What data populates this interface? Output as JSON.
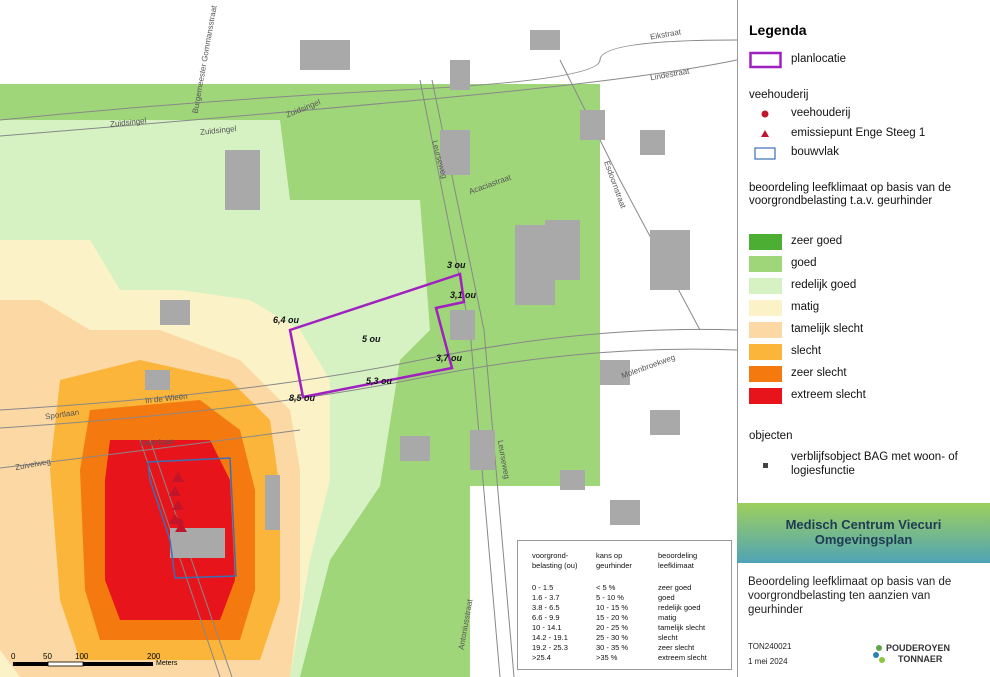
{
  "legend": {
    "title": "Legenda",
    "planlocatie": "planlocatie",
    "veehouderij_header": "veehouderij",
    "veehouderij": "veehouderij",
    "emissiepunt": "emissiepunt Enge Steeg 1",
    "bouwvlak": "bouwvlak",
    "beoordeling_header": "beoordeling leefklimaat op basis van de voorgrondbelasting t.a.v. geurhinder",
    "classes": [
      {
        "label": "zeer goed",
        "color": "#4cae33"
      },
      {
        "label": "goed",
        "color": "#9fd679"
      },
      {
        "label": "redelijk goed",
        "color": "#d6f2c2"
      },
      {
        "label": "matig",
        "color": "#fbf2c8"
      },
      {
        "label": "tamelijk slecht",
        "color": "#fcd9a4"
      },
      {
        "label": "slecht",
        "color": "#fbb53a"
      },
      {
        "label": "zeer slecht",
        "color": "#f47a10"
      },
      {
        "label": "extreem slecht",
        "color": "#e8141c"
      }
    ],
    "objecten_header": "objecten",
    "verblijf": "verblijfsobject BAG met woon- of logiesfunctie"
  },
  "title_block": {
    "line1": "Medisch Centrum Viecuri",
    "line2": "Omgevingsplan",
    "description": "Beoordeling leefklimaat op basis van de voorgrondbelasting ten aanzien van geurhinder",
    "code": "TON240021",
    "date": "1 mei 2024",
    "logo_line1": "POUDEROYEN",
    "logo_line2": "TONNAER"
  },
  "map_labels": [
    {
      "text": "3 ou"
    },
    {
      "text": "3,1 ou"
    },
    {
      "text": "6,4 ou"
    },
    {
      "text": "5 ou"
    },
    {
      "text": "3,7 ou"
    },
    {
      "text": "5,3 ou"
    },
    {
      "text": "8,5 ou"
    }
  ],
  "streets": [
    "Zuidsingel",
    "Zuidsingel",
    "Zuidsingel",
    "Leurseweg",
    "Acaciastraat",
    "Molenbroekweg",
    "Sportlaan",
    "In de Wieën",
    "Zuivelweg",
    "Deenlaan",
    "Leurseweg",
    "Antoniusstraat",
    "Burgemeester Gommansstraat",
    "Esdoornstraat",
    "Lindestraat",
    "Eikstraat"
  ],
  "inset_table": {
    "headers": [
      "voorgrond-\nbelasting (ou)",
      "kans op\ngeurhinder",
      "beoordeling\nleefklimaat"
    ],
    "rows": [
      [
        "0 - 1.5",
        "< 5 %",
        "zeer goed"
      ],
      [
        "1.6 - 3.7",
        "5 - 10 %",
        "goed"
      ],
      [
        "3.8 - 6.5",
        "10 - 15 %",
        "redelijk goed"
      ],
      [
        "6.6 - 9.9",
        "15 - 20 %",
        "matig"
      ],
      [
        "10 - 14.1",
        "20 - 25 %",
        "tamelijk slecht"
      ],
      [
        "14.2 - 19.1",
        "25 - 30 %",
        "slecht"
      ],
      [
        "19.2 - 25.3",
        "30 - 35 %",
        "zeer slecht"
      ],
      [
        ">25.4",
        ">35 %",
        "extreem slecht"
      ]
    ]
  },
  "scale": {
    "ticks": [
      "0",
      "50",
      "100",
      "200"
    ],
    "unit": "Meters"
  },
  "colors": {
    "planlocatie": "#a020c0",
    "bouwvlak": "#3a6fb5",
    "veehouderij_dot": "#c0152a"
  }
}
